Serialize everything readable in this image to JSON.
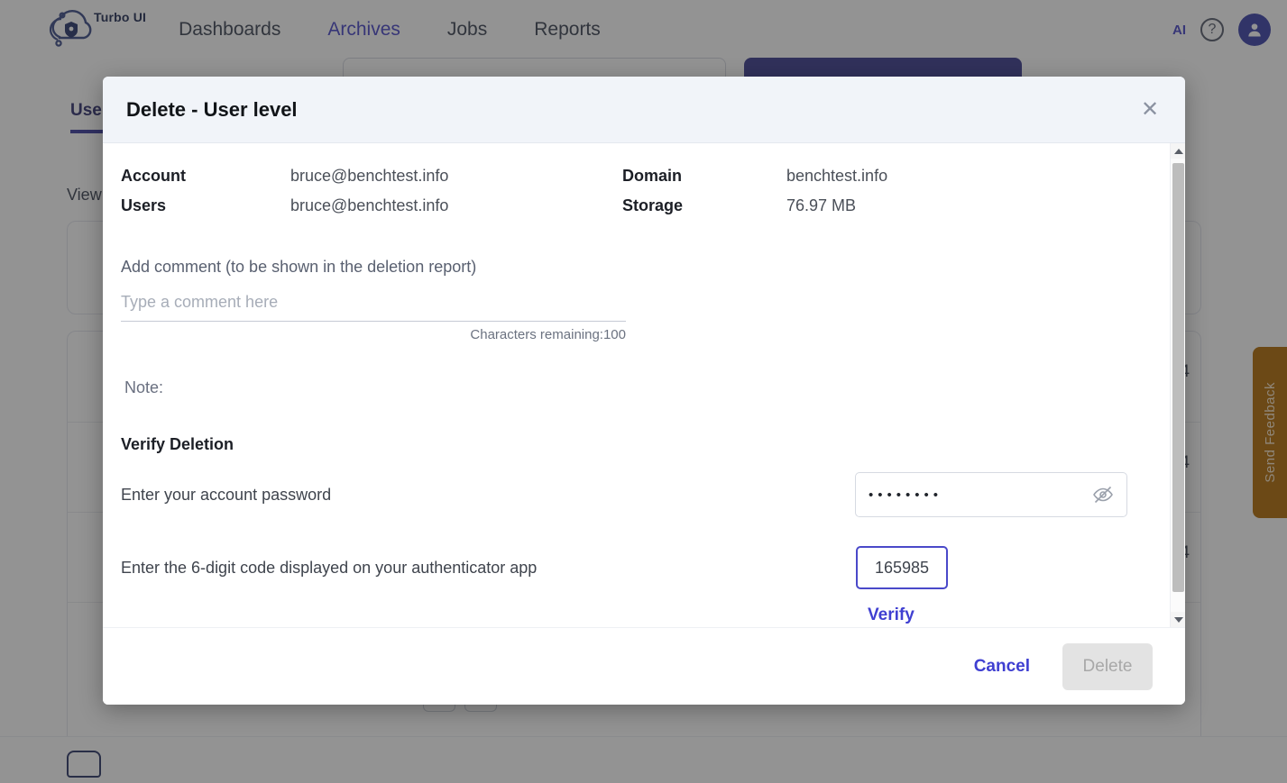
{
  "app": {
    "brand_name": "Turbo UI",
    "logo_icon": "cloud-shield-icon",
    "nav": [
      {
        "label": "Dashboards",
        "active": false
      },
      {
        "label": "Archives",
        "active": true
      },
      {
        "label": "Jobs",
        "active": false
      },
      {
        "label": "Reports",
        "active": false
      }
    ],
    "ai_chip_label": "AI",
    "help_icon": "question-circle-icon",
    "avatar_icon": "user-avatar-icon",
    "accent_color": "#4744c6",
    "primary_button_color": "#3b3b8f"
  },
  "background": {
    "tabs": [
      {
        "label": "Users",
        "active": true
      }
    ],
    "view_label": "View",
    "row_values": [
      "4",
      "4",
      "4"
    ],
    "feedback_tab_label": "Send Feedback",
    "feedback_tab_color": "#b06a05"
  },
  "modal": {
    "title": "Delete - User level",
    "close_icon": "close-icon",
    "info": [
      {
        "key": "Account",
        "value": "bruce@benchtest.info",
        "key2": "Domain",
        "value2": "benchtest.info"
      },
      {
        "key": "Users",
        "value": "bruce@benchtest.info",
        "key2": "Storage",
        "value2": "76.97 MB"
      }
    ],
    "comment": {
      "label": "Add comment (to be shown in the deletion report)",
      "placeholder": "Type a comment here",
      "value": "",
      "chars_remaining": "Characters remaining:100"
    },
    "note_label": "Note:",
    "verify_section": {
      "heading": "Verify Deletion",
      "password_label": "Enter your account password",
      "password_value": "••••••••",
      "password_toggle_icon": "eye-off-icon",
      "code_label": "Enter the 6-digit code displayed on your authenticator app",
      "code_value": "165985",
      "code_border_color": "#4a49c9",
      "verify_link_label": "Verify"
    },
    "footer": {
      "cancel_label": "Cancel",
      "delete_label": "Delete",
      "delete_disabled": true
    },
    "scrollbar": {
      "up_icon": "scroll-up-arrow-icon",
      "down_icon": "scroll-down-arrow-icon"
    }
  }
}
